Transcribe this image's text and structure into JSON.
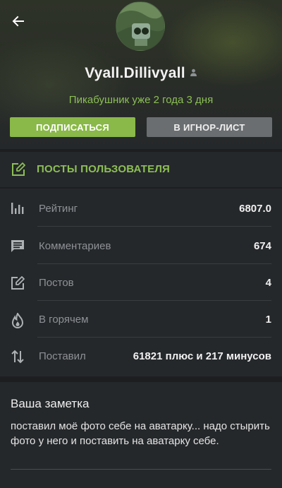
{
  "profile": {
    "username": "Vyall.Dillivyall",
    "since": "Пикабушник уже 2 года 3 дня",
    "subscribe_label": "ПОДПИСАТЬСЯ",
    "ignore_label": "В ИГНОР-ЛИСТ"
  },
  "posts_link": {
    "label": "ПОСТЫ ПОЛЬЗОВАТЕЛЯ"
  },
  "stats": [
    {
      "icon": "rating-bars-icon",
      "label": "Рейтинг",
      "value": "6807.0"
    },
    {
      "icon": "comments-icon",
      "label": "Комментариев",
      "value": "674"
    },
    {
      "icon": "posts-edit-icon",
      "label": "Постов",
      "value": "4"
    },
    {
      "icon": "hot-flame-icon",
      "label": "В горячем",
      "value": "1"
    },
    {
      "icon": "votes-arrows-icon",
      "label": "Поставил",
      "value": "61821 плюс и 217 минусов"
    }
  ],
  "note": {
    "title": "Ваша заметка",
    "text": "поставил моё фото себе на аватарку... надо стырить фото у него и поставить на аватарку себе."
  },
  "colors": {
    "accent_green": "#8ab849",
    "background": "#1c1e20",
    "panel": "#25282b",
    "muted_button": "#6b6e70"
  }
}
